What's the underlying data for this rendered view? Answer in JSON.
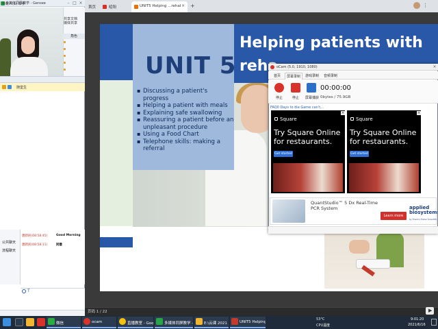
{
  "chat_app": {
    "title": "多媒体同屏教学 - Gensee",
    "side_tabs": [
      "共享文档",
      "媒体共享"
    ],
    "role_header": "角色",
    "member_tab_label": "所有人(1) 举手",
    "member_name": "随堂生",
    "chat_nav": [
      "公共聊天",
      "流程聊天"
    ],
    "messages": [
      {
        "head": "唐新民(08:58:45)",
        "text": "Good Morning"
      },
      {
        "head": "唐新民(08:58:11)",
        "text": "同意"
      }
    ]
  },
  "browser": {
    "tabs": [
      {
        "label": "首页",
        "favicon_color": "#4a8fe7"
      },
      {
        "label": "昭阳",
        "favicon_color": "#d93025"
      },
      {
        "label": "UNIT5 Helping ...rehabilitation",
        "favicon_color": "#e8710a"
      }
    ],
    "new_tab": "+"
  },
  "slide": {
    "unit_title": "UNIT 5",
    "main_title_line1": "Helping patients with",
    "main_title_line2": "reha",
    "bullets": [
      "Discussing a patient's progress",
      "Helping a patient with meals",
      "Explaining safe swallowing",
      "Reassuring a patient before an unpleasant procedure",
      "Using a Food Chart",
      "Telephone skills: making a referral"
    ]
  },
  "pdf_status": {
    "page_indicator": "页码 1 / 22"
  },
  "recorder": {
    "title": "oCam (5.0, 1910, 1080)",
    "tabs": [
      "首页",
      "屏幕录制",
      "游戏录制",
      "音频录制"
    ],
    "tools": [
      "停止",
      "停止",
      "屏幕捕获"
    ],
    "time": "00:00:00",
    "size": "0bytes / 75.9GB",
    "faq": "FAQ0 Days to die Game can't..."
  },
  "ads": {
    "brand": "Square",
    "headline_line1": "Try Square Online",
    "headline_line2": "for restaurants.",
    "cta": "Get started",
    "banner_line1": "QuantStudio™ 5 Dx Real-Time",
    "banner_line2": "PCR System",
    "banner_cta": "Learn more",
    "banner_brand_line1": "applied",
    "banner_brand_line2": "biosystems",
    "banner_brand_sub": "by Thermo Fisher Scientific"
  },
  "taskbar": {
    "items": [
      "微信",
      "ocam",
      "直播教室 - Googl...",
      "多媒体同屏教学 -...",
      "E:\\云课 2021 咸...",
      "UNIT5 Helping p..."
    ],
    "tray_temp": "53°C",
    "tray_cpu": "CPU温度",
    "time": "9:01:20",
    "date": "2021/6/16"
  }
}
